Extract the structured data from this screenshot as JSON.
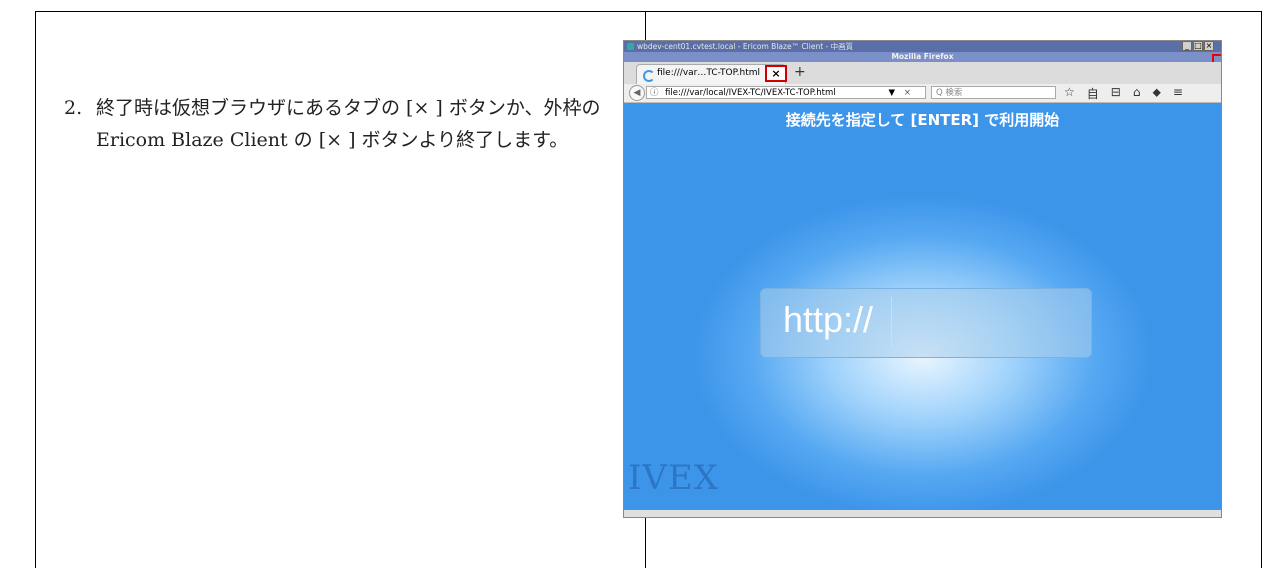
{
  "step": {
    "number": "2.",
    "text": "終了時は仮想ブラウザにあるタブの [× ] ボタンか、外枠の Ericom Blaze Client の [× ] ボタンより終了します。"
  },
  "screenshot": {
    "outer_title": "wbdev-cent01.cvtest.local - Ericom Blaze™ Client - 中画質",
    "window_buttons": [
      "_",
      "□",
      "×"
    ],
    "firefox_title": "Mozilla Firefox",
    "tab_label": "file:///var…TC-TOP.html",
    "tab_close": "×",
    "new_tab": "+",
    "url": "file:///var/local/IVEX-TC/IVEX-TC-TOP.html",
    "url_dropdown": "▼",
    "url_clear": "×",
    "search_placeholder": "Q 検索",
    "toolbar_icons": [
      "☆",
      "自",
      "⊟",
      "⌂",
      "⬥",
      "≡"
    ],
    "headline": "接続先を指定して [ENTER] で利用開始",
    "input_text": "http://",
    "logo": "IVEX"
  },
  "colors": {
    "highlight": "#d00000",
    "page_blue": "#3d95ea"
  }
}
